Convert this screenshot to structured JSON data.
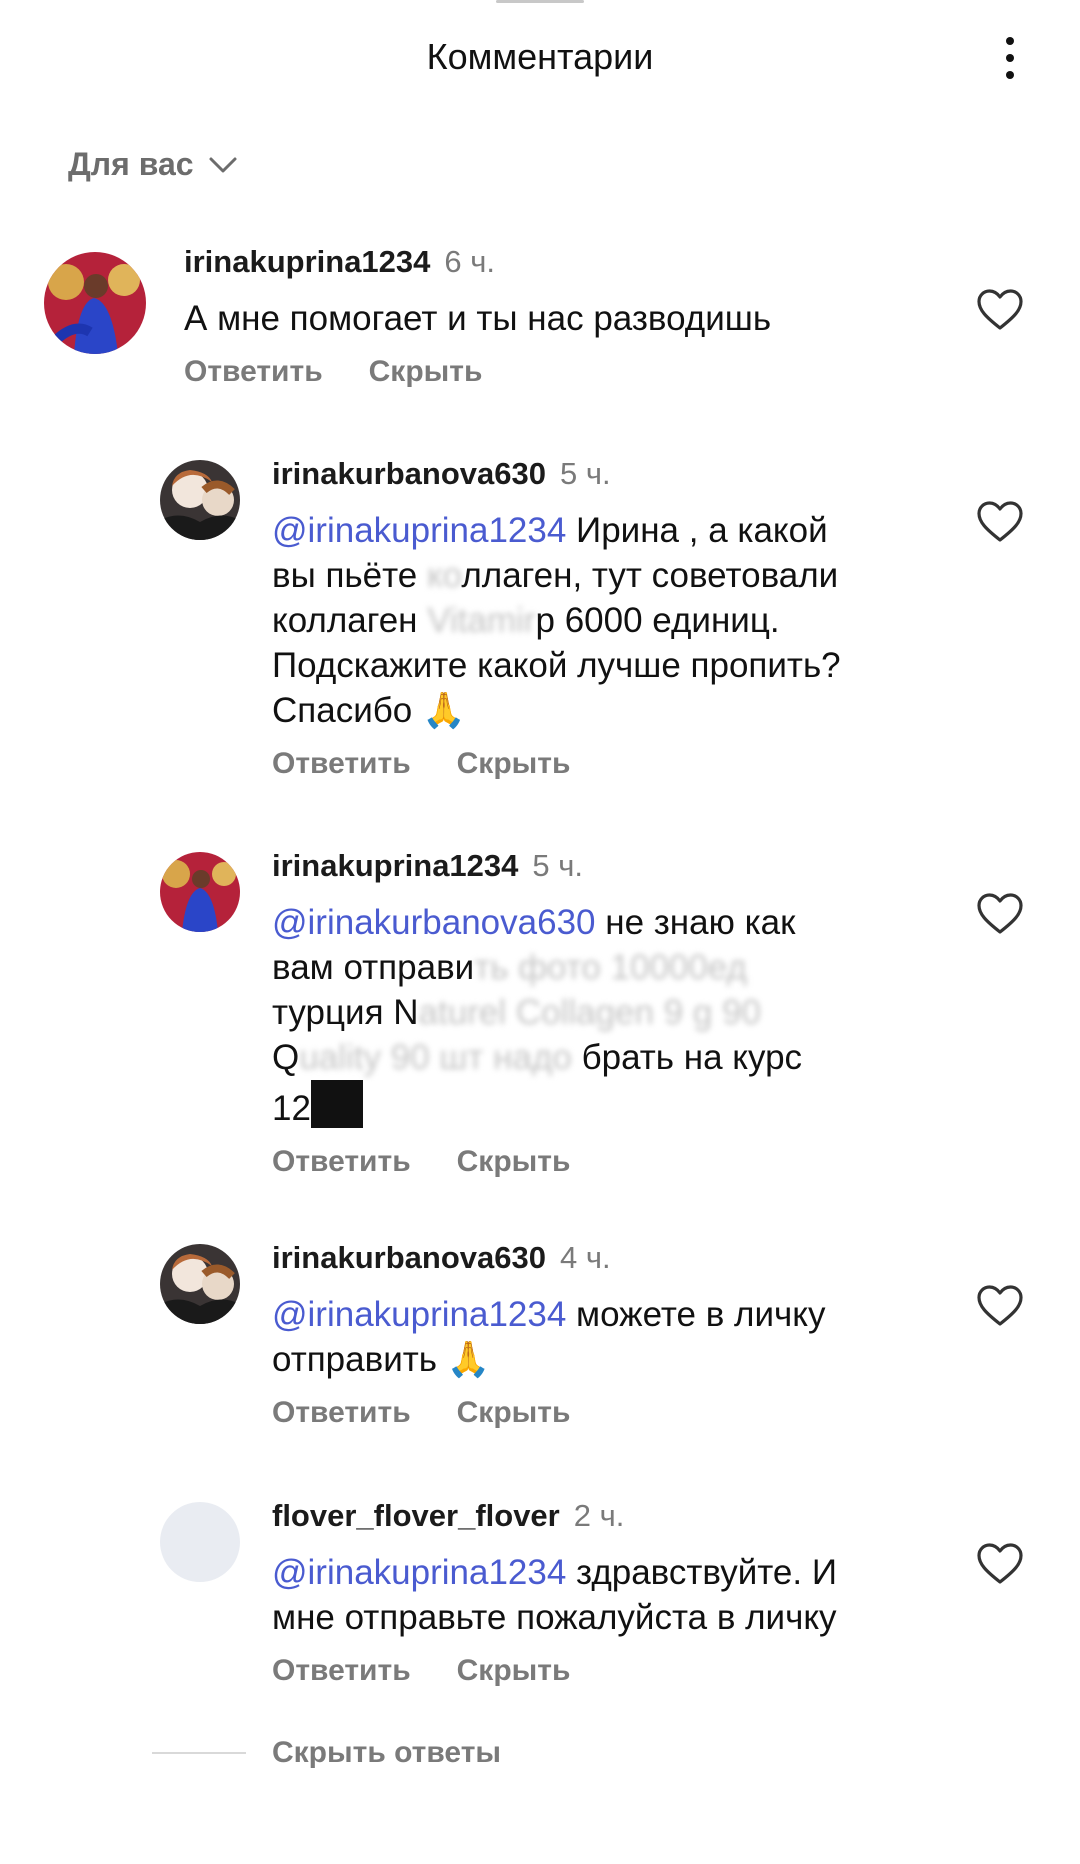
{
  "header": {
    "title": "Комментарии"
  },
  "sort": {
    "label": "Для вас"
  },
  "comments": [
    {
      "username": "irinakuprina1234",
      "time": "6 ч.",
      "text": "А мне помогает и ты нас разводишь",
      "reply_label": "Ответить",
      "hide_label": "Скрыть"
    },
    {
      "username": "irinakurbanova630",
      "time": "5 ч.",
      "mention": "@irinakuprina1234",
      "text_line1": " Ирина , а какой",
      "text_line2a": "вы пьёте ",
      "text_line2_blur": "ко",
      "text_line2b": "ллаген, тут советовали",
      "text_line3a": "коллаген ",
      "text_line3_blur": "Vitamir",
      "text_line3b": "р 6000 единиц.",
      "text_line4": "Подскажите какой лучше пропить?",
      "text_line5": "Спасибо 🙏",
      "reply_label": "Ответить",
      "hide_label": "Скрыть"
    },
    {
      "username": "irinakuprina1234",
      "time": "5 ч.",
      "mention": "@irinakurbanova630",
      "text_line1": " не знаю как",
      "text_line2a": "вам отправи",
      "text_line2_blur": "ть фото 10000ед",
      "text_line2b": "",
      "text_line3a": "турция N",
      "text_line3_blur": "aturel Collagen 9 g 90",
      "text_line3b": "",
      "text_line4a": "Q",
      "text_line4_blur": "uality 90 шт надо",
      "text_line4b": " брать на курс",
      "text_line5": "12",
      "reply_label": "Ответить",
      "hide_label": "Скрыть"
    },
    {
      "username": "irinakurbanova630",
      "time": "4 ч.",
      "mention": "@irinakuprina1234",
      "text_line1": " можете в личку",
      "text_line2": "отправить 🙏",
      "reply_label": "Ответить",
      "hide_label": "Скрыть"
    },
    {
      "username": "flover_flover_flover",
      "time": "2 ч.",
      "mention": "@irinakuprina1234",
      "text_line1": " здравствуйте.  И",
      "text_line2": "мне отправьте пожалуйста в личку",
      "reply_label": "Ответить",
      "hide_label": "Скрыть"
    }
  ],
  "hide_replies": {
    "label": "Скрыть ответы"
  },
  "icons": [
    "more-vert-icon",
    "chevron-down-icon",
    "heart-outline-icon"
  ],
  "colors": {
    "mention": "#4a5bd0",
    "secondary_text": "#7a7a7a"
  }
}
